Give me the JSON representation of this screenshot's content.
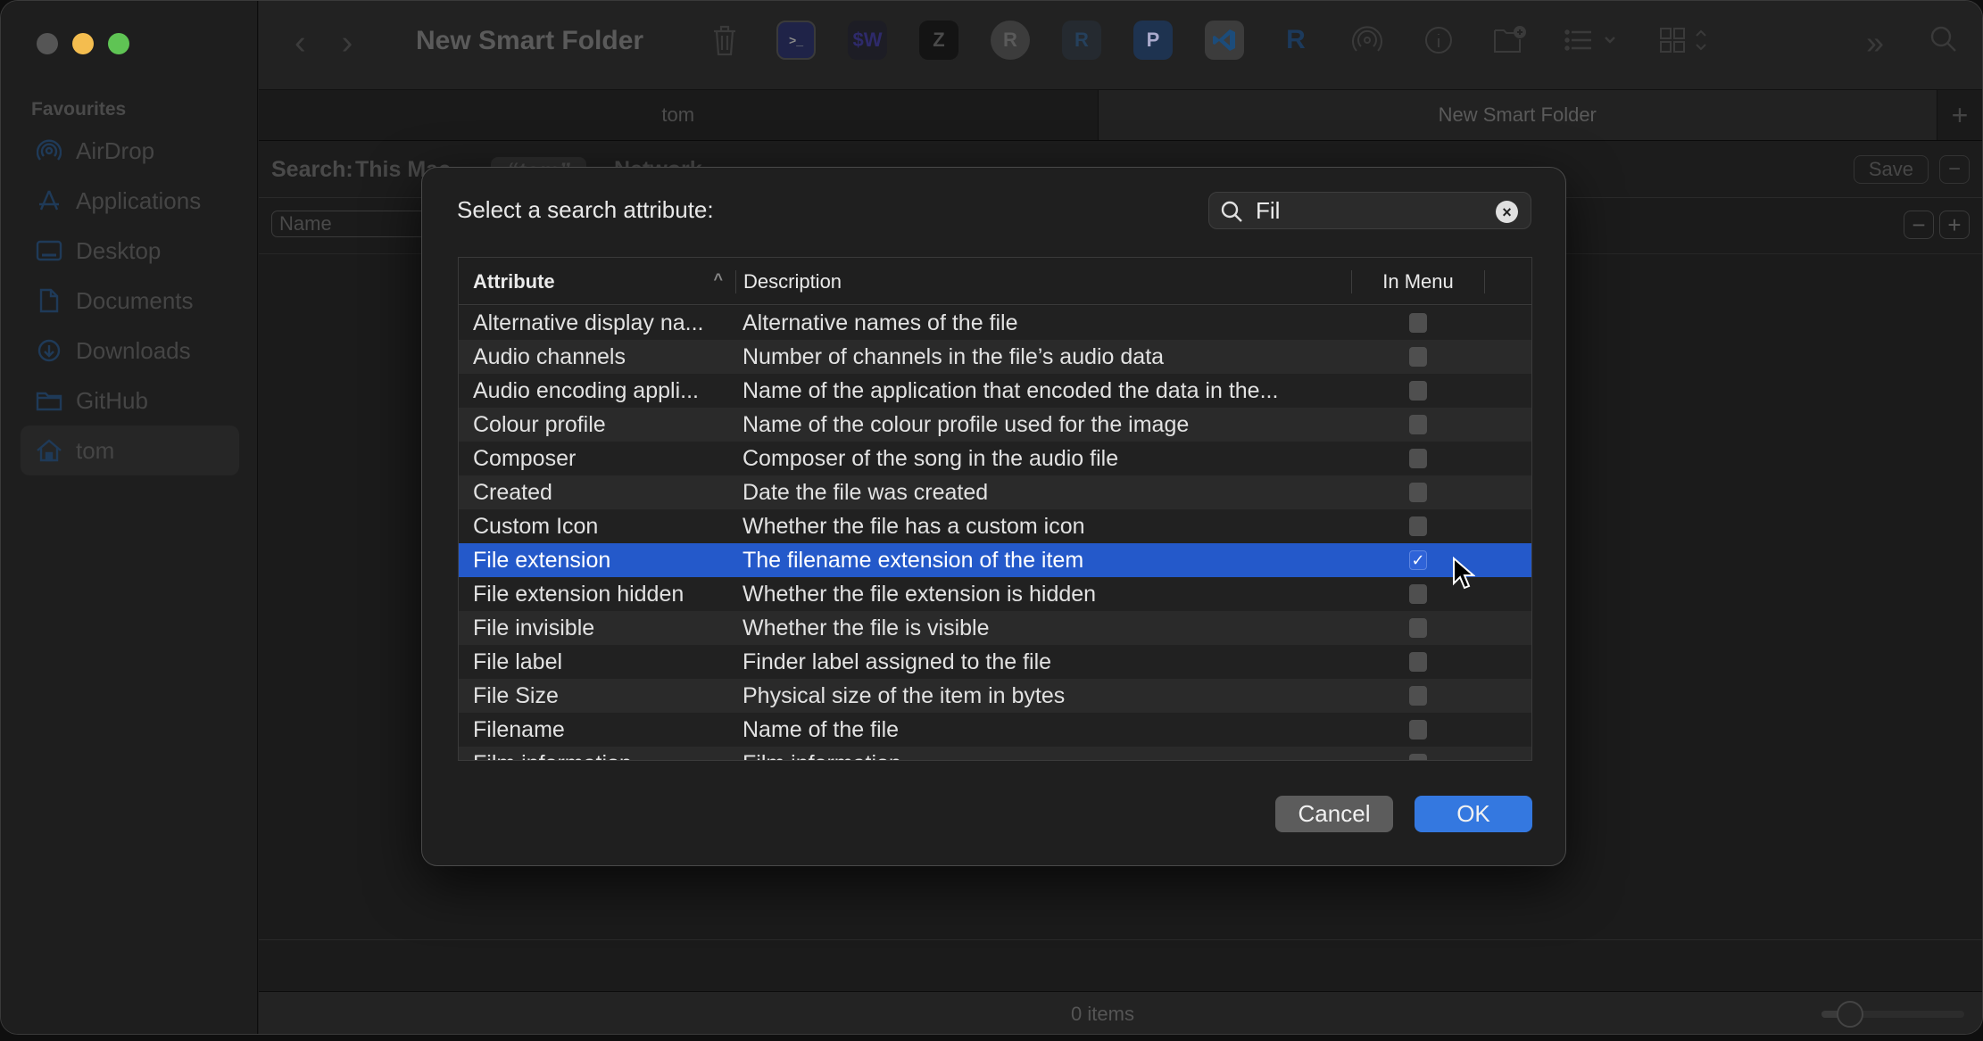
{
  "window": {
    "title": "New Smart Folder",
    "traffic_lights": [
      "close",
      "minimize",
      "maximize"
    ]
  },
  "sidebar": {
    "section": "Favourites",
    "items": [
      {
        "label": "AirDrop",
        "icon": "airdrop-icon"
      },
      {
        "label": "Applications",
        "icon": "applications-icon"
      },
      {
        "label": "Desktop",
        "icon": "desktop-icon"
      },
      {
        "label": "Documents",
        "icon": "document-icon"
      },
      {
        "label": "Downloads",
        "icon": "downloads-icon"
      },
      {
        "label": "GitHub",
        "icon": "folder-icon"
      },
      {
        "label": "tom",
        "icon": "home-icon",
        "active": true
      }
    ]
  },
  "toolbar": {
    "back": "‹",
    "forward": "›",
    "title": "New Smart Folder",
    "apps": [
      "trash",
      "terminal",
      "$W",
      "Z",
      "R",
      "R",
      "P",
      "VS Code",
      "R"
    ],
    "more": "»"
  },
  "tabs": [
    {
      "label": "tom",
      "active": false
    },
    {
      "label": "New Smart Folder",
      "active": true
    }
  ],
  "tab_add": "+",
  "search": {
    "label": "Search:",
    "scopes": [
      "This Mac",
      "“tom”",
      "Network"
    ],
    "selected_scope": "“tom”",
    "save_label": "Save",
    "remove": "−"
  },
  "criteria": {
    "attribute": "Name",
    "remove": "−",
    "add": "+"
  },
  "status": {
    "items": "0 items",
    "zoom_level": 0.2
  },
  "dialog": {
    "title": "Select a search attribute:",
    "search_value": "Fil",
    "clear": "×",
    "columns": {
      "attribute": "Attribute",
      "description": "Description",
      "in_menu": "In Menu"
    },
    "sort_indicator": "^",
    "rows": [
      {
        "attribute": "Alternative display na...",
        "description": "Alternative names of the file",
        "in_menu": false
      },
      {
        "attribute": "Audio channels",
        "description": "Number of channels in the file’s audio data",
        "in_menu": false
      },
      {
        "attribute": "Audio encoding appli...",
        "description": "Name of the application that encoded the data in the...",
        "in_menu": false
      },
      {
        "attribute": "Colour profile",
        "description": "Name of the colour profile used for the image",
        "in_menu": false
      },
      {
        "attribute": "Composer",
        "description": "Composer of the song in the audio file",
        "in_menu": false
      },
      {
        "attribute": "Created",
        "description": "Date the file was created",
        "in_menu": false
      },
      {
        "attribute": "Custom Icon",
        "description": "Whether the file has a custom icon",
        "in_menu": false
      },
      {
        "attribute": "File extension",
        "description": "The filename extension of the item",
        "in_menu": true,
        "selected": true
      },
      {
        "attribute": "File extension hidden",
        "description": "Whether the file extension is hidden",
        "in_menu": false
      },
      {
        "attribute": "File invisible",
        "description": "Whether the file is visible",
        "in_menu": false
      },
      {
        "attribute": "File label",
        "description": "Finder label assigned to the file",
        "in_menu": false
      },
      {
        "attribute": "File Size",
        "description": "Physical size of the item in bytes",
        "in_menu": false
      },
      {
        "attribute": "Filename",
        "description": "Name of the file",
        "in_menu": false
      },
      {
        "attribute": "Film information",
        "description": "Film information",
        "in_menu": false
      }
    ],
    "cancel_label": "Cancel",
    "ok_label": "OK"
  },
  "colors": {
    "accent": "#3478e0",
    "selection": "#2459ca",
    "traffic_min": "#f4bd4f",
    "traffic_max": "#5fc454"
  }
}
